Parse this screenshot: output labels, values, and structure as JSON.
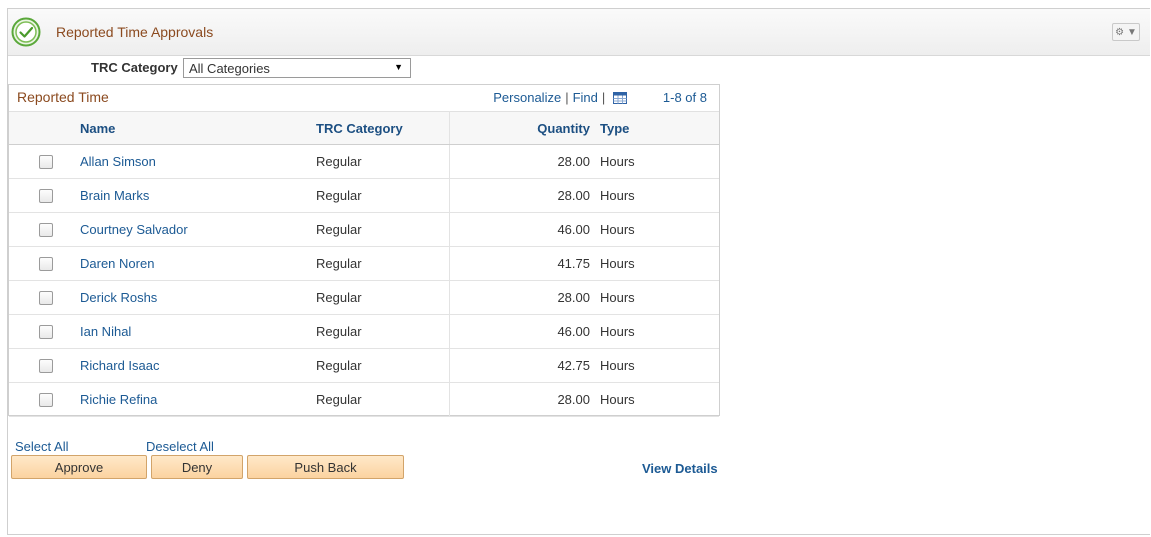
{
  "header": {
    "title": "Reported Time Approvals",
    "icon": "check-circle-icon"
  },
  "filter": {
    "label": "TRC Category",
    "selected": "All Categories"
  },
  "grid": {
    "title": "Reported Time",
    "personalize": "Personalize",
    "find": "Find",
    "separator": "|",
    "count": "1-8 of 8",
    "columns": {
      "name": "Name",
      "category": "TRC Category",
      "quantity": "Quantity",
      "type": "Type"
    },
    "rows": [
      {
        "name": "Allan Simson",
        "category": "Regular",
        "quantity": "28.00",
        "type": "Hours"
      },
      {
        "name": "Brain Marks",
        "category": "Regular",
        "quantity": "28.00",
        "type": "Hours"
      },
      {
        "name": "Courtney Salvador",
        "category": "Regular",
        "quantity": "46.00",
        "type": "Hours"
      },
      {
        "name": "Daren Noren",
        "category": "Regular",
        "quantity": "41.75",
        "type": "Hours"
      },
      {
        "name": "Derick Roshs",
        "category": "Regular",
        "quantity": "28.00",
        "type": "Hours"
      },
      {
        "name": "Ian Nihal",
        "category": "Regular",
        "quantity": "46.00",
        "type": "Hours"
      },
      {
        "name": "Richard Isaac",
        "category": "Regular",
        "quantity": "42.75",
        "type": "Hours"
      },
      {
        "name": "Richie Refina",
        "category": "Regular",
        "quantity": "28.00",
        "type": "Hours"
      }
    ]
  },
  "selection": {
    "select_all": "Select All",
    "deselect_all": "Deselect All"
  },
  "actions": {
    "approve": "Approve",
    "deny": "Deny",
    "push_back": "Push Back",
    "view_details": "View Details"
  },
  "colors": {
    "accent_title": "#8b4a1f",
    "link": "#1c5a94",
    "button_bg": "#fbd3a0",
    "check_green": "#5aa83a"
  }
}
